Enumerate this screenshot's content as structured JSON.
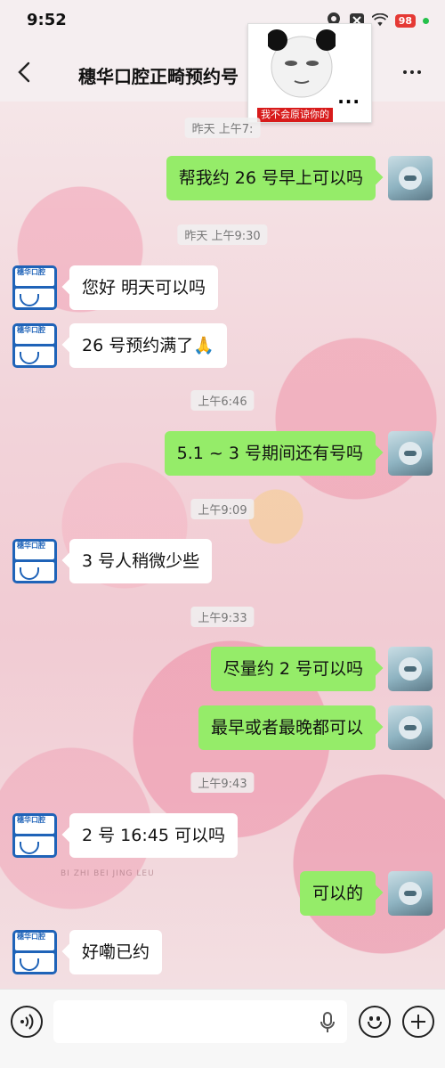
{
  "status_bar": {
    "time": "9:52",
    "battery": "98"
  },
  "header": {
    "title": "穗华口腔正畸预约号"
  },
  "sticker": {
    "caption": "我不会原谅你的",
    "dots": "..."
  },
  "messages": [
    {
      "type": "timestamp",
      "text": "昨天 上午7:"
    },
    {
      "type": "out",
      "text": "帮我约 26 号早上可以吗"
    },
    {
      "type": "timestamp",
      "text": "昨天 上午9:30"
    },
    {
      "type": "in",
      "text": "您好 明天可以吗"
    },
    {
      "type": "in",
      "text": "26 号预约满了🙏"
    },
    {
      "type": "timestamp",
      "text": "上午6:46"
    },
    {
      "type": "out",
      "text": "5.1 ~ 3 号期间还有号吗"
    },
    {
      "type": "timestamp",
      "text": "上午9:09"
    },
    {
      "type": "in",
      "text": "3 号人稍微少些"
    },
    {
      "type": "timestamp",
      "text": "上午9:33"
    },
    {
      "type": "out",
      "text": "尽量约 2 号可以吗"
    },
    {
      "type": "out",
      "text": "最早或者最晚都可以"
    },
    {
      "type": "timestamp",
      "text": "上午9:43"
    },
    {
      "type": "in",
      "text": "2 号 16:45 可以吗"
    },
    {
      "type": "out",
      "text": "可以的"
    },
    {
      "type": "in",
      "text": "好嘞已约"
    }
  ],
  "avatar_text": "穗华口腔",
  "watermark": "BI ZHI BEI JING LEU",
  "input": {
    "value": ""
  },
  "colors": {
    "out_bubble": "#95ec69",
    "in_bubble": "#ffffff",
    "avatar_bg": "#1f63b8"
  }
}
